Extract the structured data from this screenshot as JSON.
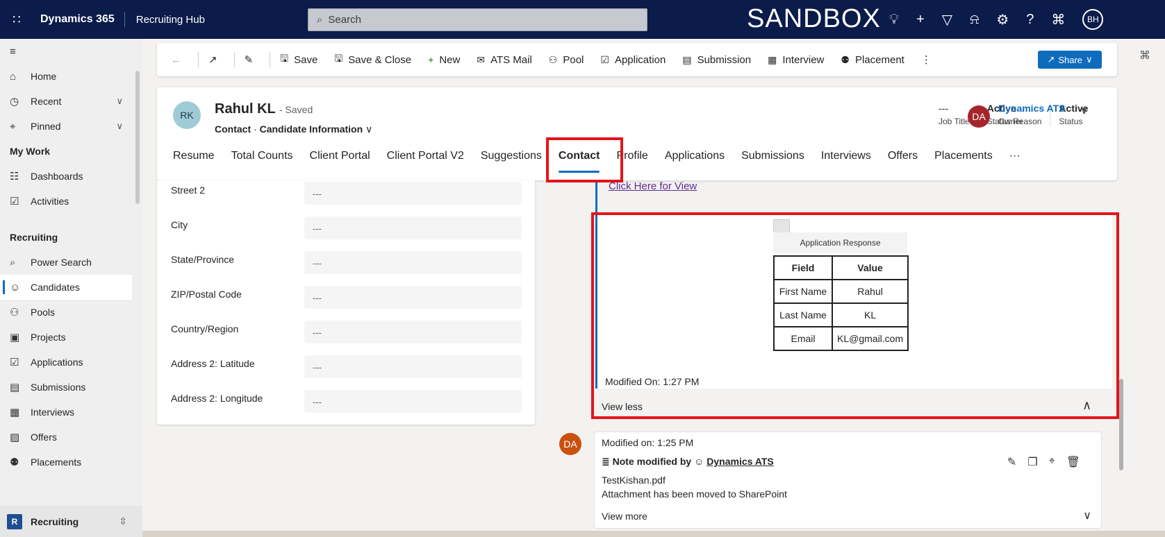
{
  "topbar": {
    "brand": "Dynamics 365",
    "app_name": "Recruiting Hub",
    "search_placeholder": "Search",
    "environment": "SANDBOX",
    "user_initials": "BH"
  },
  "nav": {
    "items_top": [
      {
        "label": "Home",
        "icon": "home-icon"
      },
      {
        "label": "Recent",
        "icon": "clock-icon"
      },
      {
        "label": "Pinned",
        "icon": "pin-icon"
      }
    ],
    "section_mywork": "My Work",
    "mywork_items": [
      {
        "label": "Dashboards",
        "icon": "dashboard-icon"
      },
      {
        "label": "Activities",
        "icon": "activities-icon"
      }
    ],
    "section_recruiting": "Recruiting",
    "recruiting_items": [
      {
        "label": "Power Search",
        "icon": "search-icon"
      },
      {
        "label": "Candidates",
        "icon": "person-icon"
      },
      {
        "label": "Pools",
        "icon": "pool-icon"
      },
      {
        "label": "Projects",
        "icon": "briefcase-icon"
      },
      {
        "label": "Applications",
        "icon": "checkbox-icon"
      },
      {
        "label": "Submissions",
        "icon": "submission-icon"
      },
      {
        "label": "Interviews",
        "icon": "calendar-icon"
      },
      {
        "label": "Offers",
        "icon": "offer-icon"
      },
      {
        "label": "Placements",
        "icon": "placement-icon"
      }
    ],
    "area_badge": "R",
    "area_label": "Recruiting"
  },
  "commands": {
    "save": "Save",
    "save_close": "Save & Close",
    "new": "New",
    "ats_mail": "ATS Mail",
    "pool": "Pool",
    "application": "Application",
    "submission": "Submission",
    "interview": "Interview",
    "placement": "Placement",
    "share": "Share"
  },
  "record": {
    "initials": "RK",
    "name": "Rahul KL",
    "saved": "- Saved",
    "entity": "Contact",
    "form": "Candidate Information",
    "job_title_value": "---",
    "job_title_label": "Job Title",
    "status_reason_value": "Active",
    "status_reason_label": "Status Reason",
    "status_value": "Active",
    "status_label": "Status",
    "owner_initials": "DA",
    "owner_name": "Dynamics ATS",
    "owner_label": "Owner"
  },
  "tabs": [
    "Resume",
    "Total Counts",
    "Client Portal",
    "Client Portal V2",
    "Suggestions",
    "Contact",
    "Profile",
    "Applications",
    "Submissions",
    "Interviews",
    "Offers",
    "Placements",
    "···"
  ],
  "form_fields": [
    {
      "label": "Street 2",
      "value": "---"
    },
    {
      "label": "City",
      "value": "---"
    },
    {
      "label": "State/Province",
      "value": "---"
    },
    {
      "label": "ZIP/Postal Code",
      "value": "---"
    },
    {
      "label": "Country/Region",
      "value": "---"
    },
    {
      "label": "Address 2: Latitude",
      "value": "---"
    },
    {
      "label": "Address 2: Longitude",
      "value": "---"
    }
  ],
  "timeline": {
    "link": "Click Here for View",
    "response_title": "Application Response",
    "table_headers": [
      "Field",
      "Value"
    ],
    "table_rows": [
      [
        "First Name",
        "Rahul"
      ],
      [
        "Last Name",
        "KL"
      ],
      [
        "Email",
        "KL@gmail.com"
      ]
    ],
    "modified": "Modified On: 1:27 PM",
    "view_less": "View less",
    "note2": {
      "initials": "DA",
      "modified": "Modified on: 1:25 PM",
      "by_prefix": "Note modified by",
      "by_user": "Dynamics ATS",
      "file": "TestKishan.pdf",
      "message": "Attachment has been moved to SharePoint",
      "view_more": "View more"
    }
  },
  "colors": {
    "topbar": "#0b1b4a",
    "accent": "#0f6cbd",
    "highlight": "#e3151a"
  }
}
